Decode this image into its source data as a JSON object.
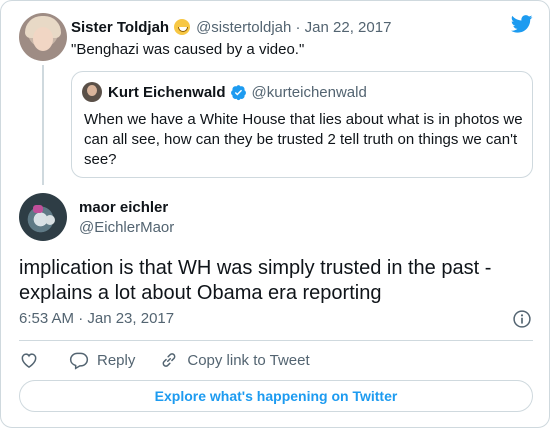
{
  "colors": {
    "accent": "#1d9bf0",
    "secondary_text": "#536471",
    "border": "#cfd9de"
  },
  "parent_tweet": {
    "name": "Sister Toldjah",
    "emoji": "grinning-face-emoji",
    "handle_date": "@sistertoldjah · Jan 22, 2017",
    "text": "\"Benghazi was caused by a video.\""
  },
  "quoted_tweet": {
    "name": "Kurt Eichenwald",
    "verified_icon": "verified-badge-icon",
    "handle": "@kurteichenwald",
    "text": "When we have a White House that lies about what is in photos we can all see, how can they be trusted 2 tell truth on things we can't see?"
  },
  "main_tweet": {
    "name": "maor eichler",
    "handle": "@EichlerMaor",
    "text": "implication is that WH was simply trusted in the past - explains a lot about Obama era reporting",
    "timestamp": "6:53 AM · Jan 23, 2017"
  },
  "actions": {
    "like_icon": "heart-icon",
    "reply_label": "Reply",
    "copy_label": "Copy link to Tweet"
  },
  "footer": {
    "explore_label": "Explore what's happening on Twitter"
  }
}
